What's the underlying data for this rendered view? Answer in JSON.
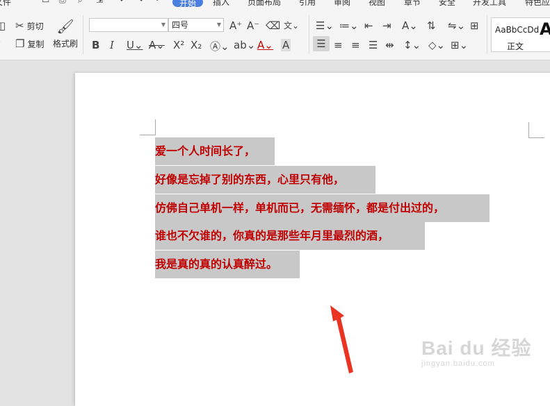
{
  "menu": {
    "items": [
      "文件",
      "开始",
      "插入",
      "页面布局",
      "引用",
      "审阅",
      "视图",
      "章节",
      "安全",
      "开发工具",
      "特色应用"
    ],
    "active": "开始"
  },
  "ribbon": {
    "cut_label": "剪切",
    "copy_label": "复制",
    "format_painter_label": "格式刷",
    "font_name": "",
    "font_size": "四号",
    "styles_preview": "AaBbCcDd",
    "style_name": "正文",
    "style_big_letter": "A"
  },
  "document": {
    "lines": [
      "爱一个人时间长了，",
      "好像是忘掉了别的东西，心里只有他，",
      "仿佛自己单机一样，单机而已，无需缅怀，都是付出过的，",
      "谁也不欠谁的，你真的是那些年月里最烈的酒，",
      "我是真的真的认真醉过。"
    ],
    "text_color": "#c00000",
    "highlight_color": "#c8c8c8"
  },
  "annotation": {
    "arrow_color": "#ea3323"
  },
  "watermark": {
    "brand": "Bai du 经验",
    "url": "jingyan.baidu.com"
  }
}
